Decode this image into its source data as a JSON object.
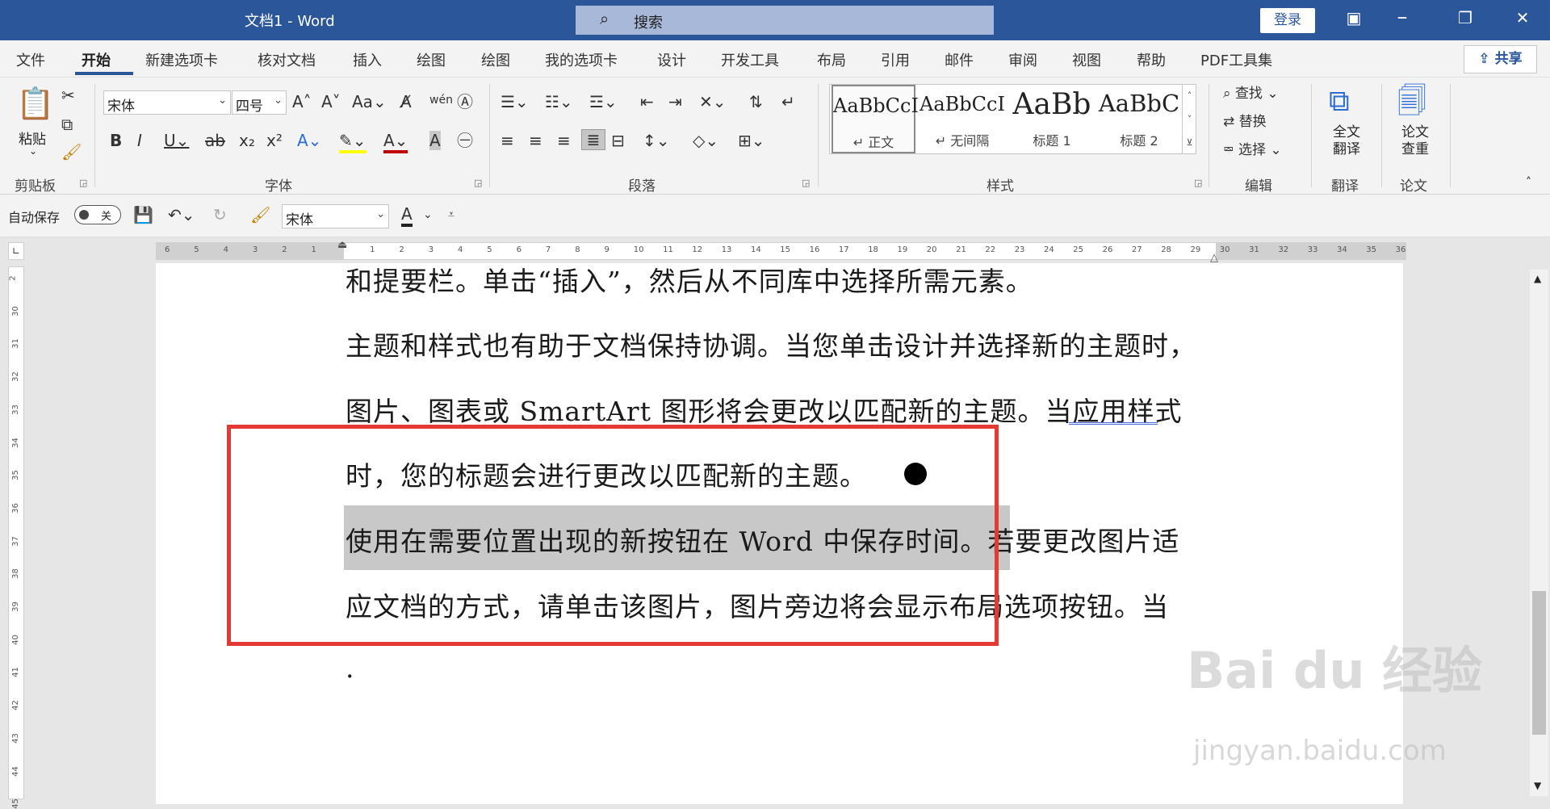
{
  "titlebar": {
    "doc_title": "文档1  -  Word",
    "search_placeholder": "搜索",
    "login": "登录"
  },
  "tabs": [
    "文件",
    "开始",
    "新建选项卡",
    "核对文档",
    "插入",
    "绘图",
    "绘图",
    "我的选项卡",
    "设计",
    "开发工具",
    "布局",
    "引用",
    "邮件",
    "审阅",
    "视图",
    "帮助",
    "PDF工具集"
  ],
  "share": "共享",
  "ribbon": {
    "clipboard": {
      "paste": "粘贴",
      "label": "剪贴板"
    },
    "font": {
      "name": "宋体",
      "size": "四号",
      "label": "字体"
    },
    "paragraph": {
      "label": "段落"
    },
    "styles": {
      "label": "样式",
      "items": [
        {
          "preview": "AaBbCcI",
          "name": "↵ 正文"
        },
        {
          "preview": "AaBbCcI",
          "name": "↵ 无间隔"
        },
        {
          "preview": "AaBb",
          "name": "标题 1"
        },
        {
          "preview": "AaBbC",
          "name": "标题 2"
        }
      ]
    },
    "editing": {
      "find": "查找",
      "replace": "替换",
      "select": "选择",
      "label": "编辑"
    },
    "translate": {
      "btn": "全文翻译",
      "label": "翻译"
    },
    "paper": {
      "btn": "论文查重",
      "label": "论文"
    }
  },
  "qat": {
    "autosave": "自动保存",
    "autosave_state": "关",
    "font": "宋体"
  },
  "ruler": {
    "h_numbers": [
      "6",
      "5",
      "4",
      "3",
      "2",
      "1",
      "",
      "1",
      "2",
      "3",
      "4",
      "5",
      "6",
      "7",
      "8",
      "9",
      "10",
      "11",
      "12",
      "13",
      "14",
      "15",
      "16",
      "17",
      "18",
      "19",
      "20",
      "21",
      "22",
      "23",
      "24",
      "25",
      "26",
      "27",
      "28",
      "29",
      "30",
      "31",
      "32",
      "33",
      "34",
      "35",
      "36"
    ],
    "v_numbers": [
      "2",
      "30",
      "31",
      "32",
      "33",
      "34",
      "35",
      "36",
      "37",
      "38",
      "39",
      "40",
      "41",
      "42",
      "43",
      "44",
      "45"
    ]
  },
  "document": {
    "lines": [
      "和提要栏。单击“插入”，然后从不同库中选择所需元素。",
      "主题和样式也有助于文档保持协调。当您单击设计并选择新的主题时，",
      "图片、图表或 SmartArt 图形将会更改以匹配新的主题。当应用样式",
      "时，您的标题会进行更改以匹配新的主题。",
      "使用在需要位置出现的新按钮在 Word 中保存时间。若要更改图片适",
      "应文档的方式，请单击该图片，图片旁边将会显示布局选项按钮。当",
      "."
    ]
  },
  "watermark": {
    "brand": "Bai du 经验",
    "url": "jingyan.baidu.com"
  }
}
